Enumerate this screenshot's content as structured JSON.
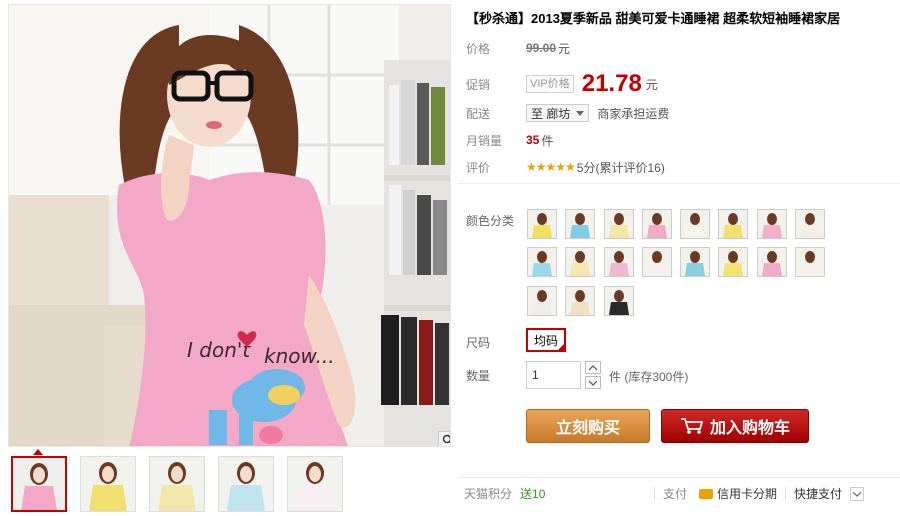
{
  "product": {
    "title": "【秒杀通】2013夏季新品 甜美可爱卡通睡裙 超柔软短袖睡裙家居",
    "price_label": "价格",
    "original_price": "99.00",
    "currency_unit": "元",
    "promo_label": "促销",
    "vip_tag": "VIP价格",
    "promo_price": "21.78",
    "shipping_label": "配送",
    "shipping_dest": "至 廊坊",
    "shipping_note": "商家承担运费",
    "monthly_sales_label": "月销量",
    "monthly_sales": "35",
    "sales_unit": "件",
    "rating_label": "评价",
    "stars": "★★★★★",
    "rating_text": "5分(累计评价16)",
    "rating_score": 5
  },
  "options": {
    "color_label": "颜色分类",
    "size_label": "尺码",
    "size_selected": "均码",
    "quantity_label": "数量",
    "quantity_value": "1",
    "quantity_note": "件 (库存300件)"
  },
  "actions": {
    "buy_now": "立刻购买",
    "add_to_cart": "加入购物车"
  },
  "footer": {
    "points_label": "天猫积分",
    "points_value": "送10",
    "pay_label": "支付",
    "credit_card": "信用卡分期",
    "quick_pay": "快捷支付"
  },
  "colors": {
    "accent": "#c40000",
    "buy_orange": "#d98a3a",
    "shirt_pink": "#f4a8c8",
    "green": "#3a9a2a"
  }
}
